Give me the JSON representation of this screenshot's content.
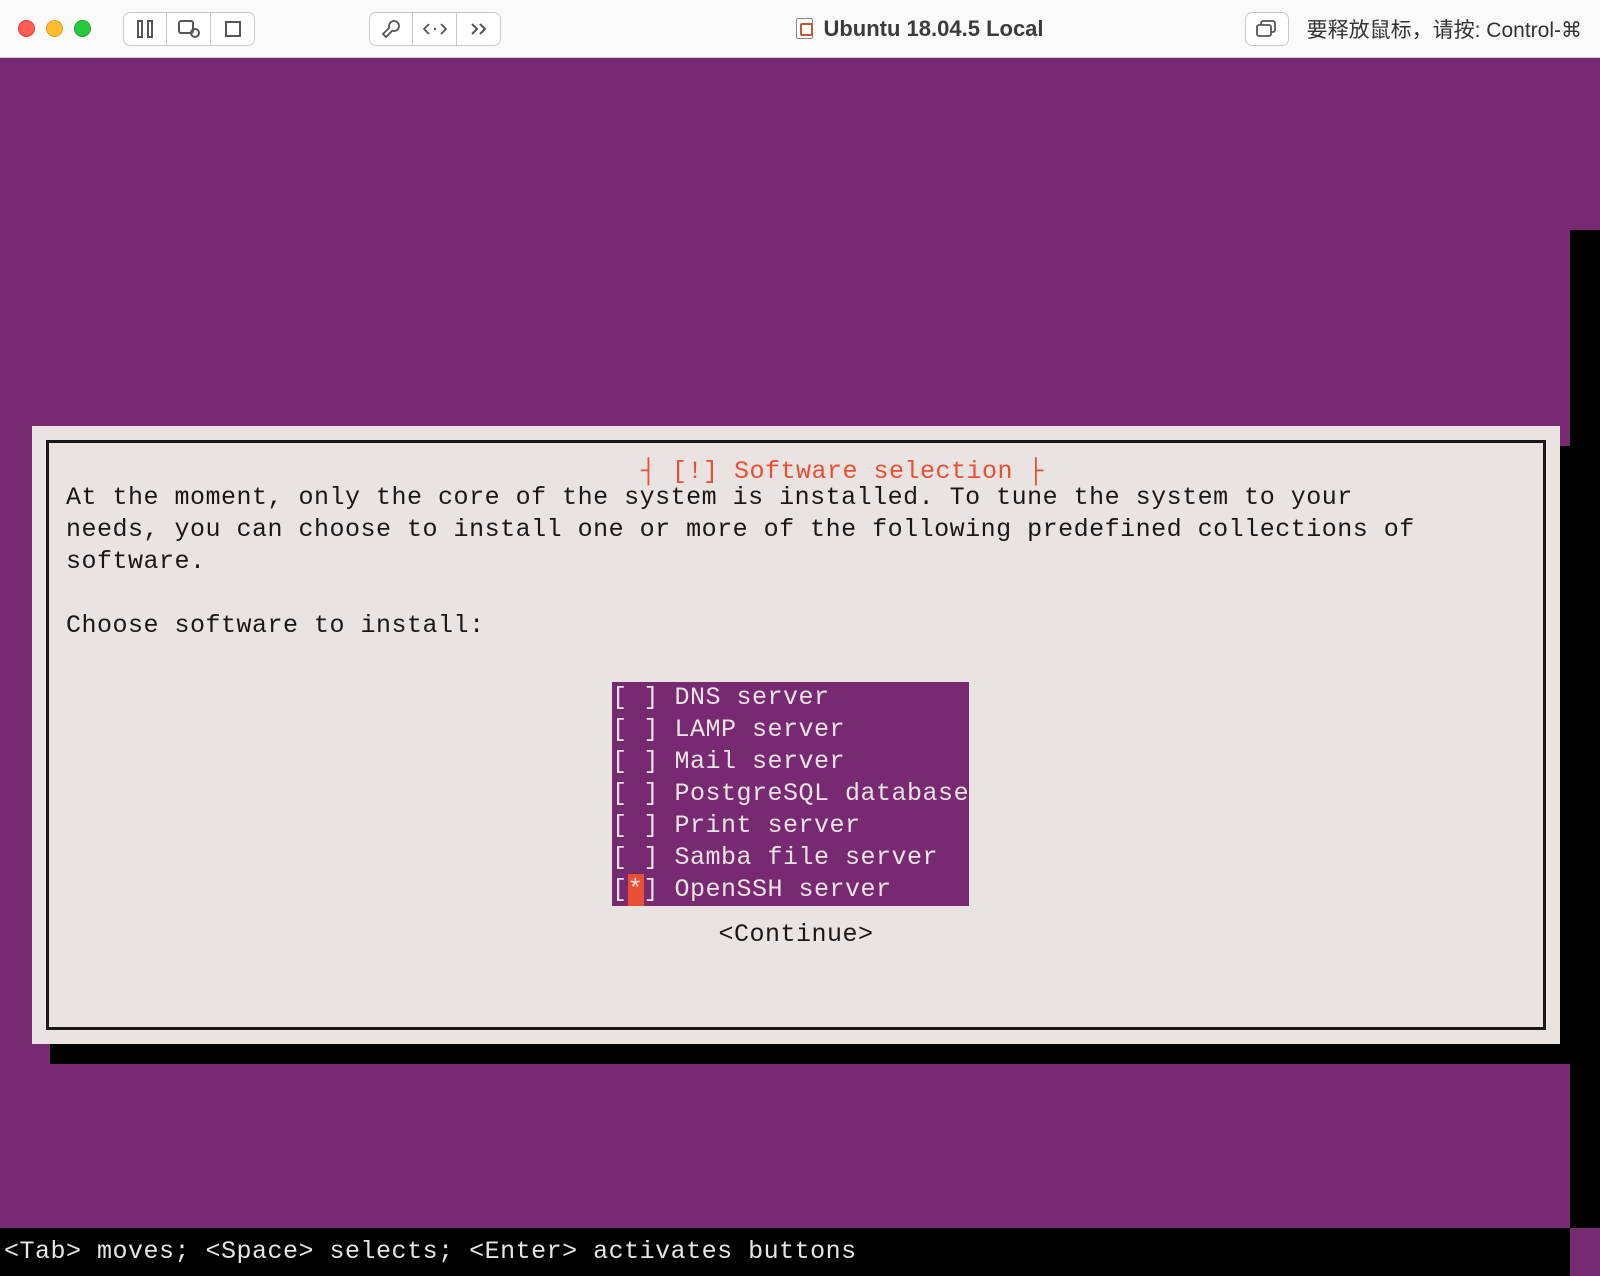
{
  "titlebar": {
    "window_title": "Ubuntu 18.04.5 Local",
    "release_hint": "要释放鼠标，请按: Control-⌘"
  },
  "dialog": {
    "title": "[!] Software selection",
    "para": "At the moment, only the core of the system is installed. To tune the system to your\nneeds, you can choose to install one or more of the following predefined collections of\nsoftware.",
    "prompt": "Choose software to install:",
    "continue": "<Continue>"
  },
  "software": [
    {
      "label": "DNS server",
      "selected": false
    },
    {
      "label": "LAMP server",
      "selected": false
    },
    {
      "label": "Mail server",
      "selected": false
    },
    {
      "label": "PostgreSQL database",
      "selected": false
    },
    {
      "label": "Print server",
      "selected": false
    },
    {
      "label": "Samba file server",
      "selected": false
    },
    {
      "label": "OpenSSH server",
      "selected": true,
      "cursor": true
    }
  ],
  "help_bar": "<Tab> moves; <Space> selects; <Enter> activates buttons",
  "colors": {
    "bg_purple": "#772a72",
    "panel_grey": "#e9e4e1",
    "accent_red": "#e84f33",
    "text_dark": "#1a171b"
  }
}
